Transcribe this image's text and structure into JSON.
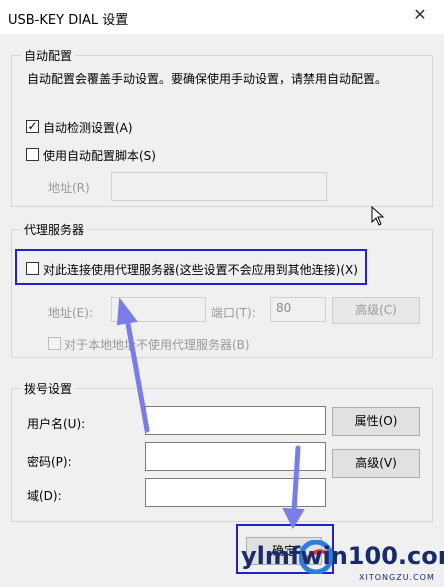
{
  "window": {
    "title": "USB-KEY DIAL 设置",
    "close_label": "✕"
  },
  "auto_config": {
    "legend": "自动配置",
    "description": "自动配置会覆盖手动设置。要确保使用手动设置，请禁用自动配置。",
    "auto_detect_label": "自动检测设置(A)",
    "auto_detect_checked": true,
    "use_script_label": "使用自动配置脚本(S)",
    "use_script_checked": false,
    "address_label": "地址(R)",
    "address_value": ""
  },
  "proxy": {
    "legend": "代理服务器",
    "use_proxy_label": "对此连接使用代理服务器(这些设置不会应用到其他连接)(X)",
    "use_proxy_checked": false,
    "address_label": "地址(E):",
    "address_value": "",
    "port_label": "端口(T):",
    "port_value": "80",
    "advanced_label": "高级(C)",
    "bypass_label": "对于本地地址不使用代理服务器(B)",
    "bypass_checked": false
  },
  "dial": {
    "legend": "拨号设置",
    "username_label": "用户名(U):",
    "username_value": "",
    "password_label": "密码(P):",
    "password_value": "",
    "domain_label": "域(D):",
    "domain_value": "",
    "properties_label": "属性(O)",
    "advanced_label": "高级(V)"
  },
  "footer": {
    "ok_label": "确定"
  },
  "watermark": {
    "text": "ylmfwin100.com",
    "sub": "XITONGZU.COM"
  },
  "colors": {
    "highlight": "#2222cc",
    "arrow": "#7b7bea"
  }
}
